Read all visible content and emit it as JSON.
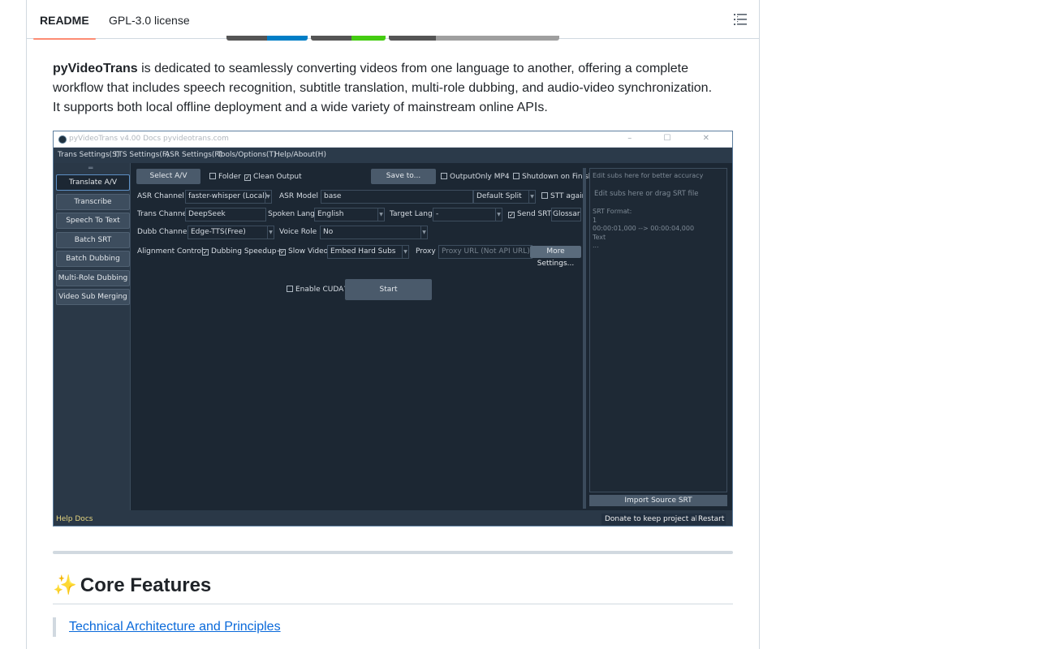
{
  "tabs": [
    {
      "label": "README",
      "active": true
    },
    {
      "label": "GPL-3.0 license",
      "active": false
    }
  ],
  "toc_icon": "list-unordered-icon",
  "intro": {
    "brand": "pyVideoTrans",
    "text": " is dedicated to seamlessly converting videos from one language to another, offering a complete workflow that includes speech recognition, subtitle translation, multi-role dubbing, and audio-video synchronization. It supports both local offline deployment and a wide variety of mainstream online APIs."
  },
  "app": {
    "window_title": "pyVideoTrans v4.00 Docs pyvideotrans.com",
    "window_controls": "– ☐ ✕",
    "menu": [
      "Trans Settings(S)",
      "TTS Settings(F)",
      "ASR Settings(R)",
      "Tools/Options(T)",
      "Help/About(H)"
    ],
    "sidebar_grip": "═",
    "sidebar": [
      "Translate A/V",
      "Transcribe Translate",
      "Speech To Text",
      "Batch SRT Translate",
      "Batch Dubbing",
      "Multi-Role Dubbing",
      "Video Sub Merging"
    ],
    "row1": {
      "select_btn": "Select A/V",
      "folder": "Folder",
      "clean_output": "Clean Output",
      "save_btn": "Save to...",
      "output_only": "OutputOnly MP4",
      "shutdown": "Shutdown on Finish"
    },
    "row2": {
      "asr_channel_label": "ASR  Channel",
      "asr_channel": "faster-whisper (Local)",
      "asr_model_label": "ASR Model",
      "asr_model": "base",
      "split": "Default Split",
      "stt_again": "STT again"
    },
    "row3": {
      "trans_channel_label": "Trans Channel",
      "trans_channel": "DeepSeek",
      "spoken_lang_label": "Spoken Lang",
      "spoken_lang": "English",
      "target_lang_label": "Target Lang",
      "target_lang": "-",
      "send_srt": "Send SRT",
      "glossary_btn": "Glossary"
    },
    "row4": {
      "dubb_channel_label": "Dubb Channel",
      "dubb_channel": "Edge-TTS(Free)",
      "voice_role_label": "Voice Role",
      "voice_role": "No"
    },
    "row5": {
      "alignment_label": "Alignment Control",
      "dubbing_speedup": "Dubbing Speedup+",
      "slow_video": "Slow Video",
      "embed_subs": "Embed Hard Subs",
      "proxy_label": "Proxy",
      "proxy_placeholder": "Proxy URL (Not API URL)",
      "more_btn": "More Settings..."
    },
    "cuda": "Enable CUDA?",
    "start_btn": "Start",
    "right_panel": {
      "hint1": "Edit subs here for better accuracy",
      "hint2": "Edit subs here or drag SRT file",
      "format_label": "SRT Format:",
      "line1": "1",
      "line2": "00:00:01,000 --> 00:00:04,000",
      "line3": "Text",
      "line4": "..."
    },
    "import_btn": "Import Source SRT",
    "status": {
      "help": "Help Docs",
      "donate": "Donate to keep project alive!",
      "restart": "Restart"
    }
  },
  "section": {
    "icon": "✨",
    "title": "Core Features"
  },
  "quote_link": "Technical Architecture and Principles",
  "colors": {
    "accent_tab": "#fd8c73",
    "link": "#0969da",
    "app_bg": "#1c2733"
  }
}
